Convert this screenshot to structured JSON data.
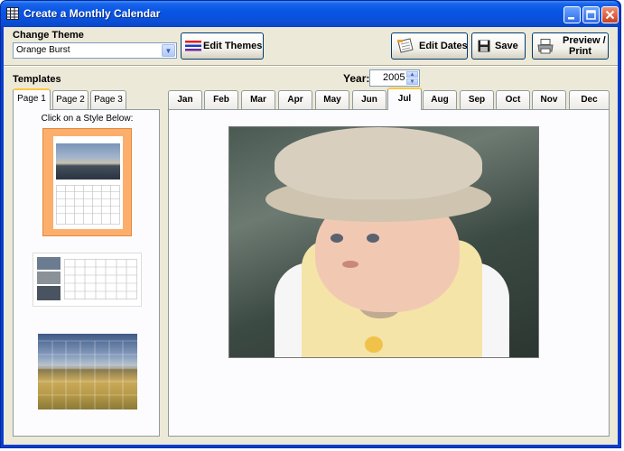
{
  "window": {
    "title": "Create a Monthly Calendar",
    "controls": {
      "minimize": "–",
      "maximize": "□",
      "close": "✕"
    }
  },
  "toolbar": {
    "theme_label": "Change Theme",
    "theme_value": "Orange Burst",
    "edit_themes": "Edit Themes",
    "edit_dates": "Edit Dates",
    "save": "Save",
    "preview_line1": "Preview /",
    "preview_line2": "Print"
  },
  "templates": {
    "label": "Templates",
    "tabs": [
      "Page 1",
      "Page 2",
      "Page 3"
    ],
    "active_tab": "Page 1",
    "instruction": "Click on a Style Below:",
    "thumbnails": [
      "template-orange-frame",
      "template-side-photos",
      "template-landscape"
    ]
  },
  "year": {
    "label": "Year:",
    "value": "2005"
  },
  "months": {
    "tabs": [
      "Jan",
      "Feb",
      "Mar",
      "Apr",
      "May",
      "Jun",
      "Jul",
      "Aug",
      "Sep",
      "Oct",
      "Nov",
      "Dec"
    ],
    "active": "Jul"
  },
  "icons": {
    "app": "calendar-grid-icon",
    "edit_themes": "color-lines-icon",
    "edit_dates": "notepad-icon",
    "save": "floppy-disk-icon",
    "preview": "printer-icon"
  },
  "colors": {
    "titlebar": "#0856e6",
    "tab_highlight": "#ffc83c",
    "template_orange": "#fcae6c"
  }
}
